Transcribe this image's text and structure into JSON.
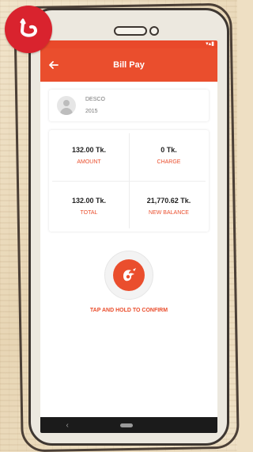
{
  "app": {
    "title": "Bill Pay"
  },
  "biller": {
    "name": "DESCO",
    "code": "2015"
  },
  "summary": [
    {
      "value": "132.00 Tk.",
      "label": "AMOUNT"
    },
    {
      "value": "0 Tk.",
      "label": "CHARGE"
    },
    {
      "value": "132.00 Tk.",
      "label": "TOTAL"
    },
    {
      "value": "21,770.62 Tk.",
      "label": "NEW BALANCE"
    }
  ],
  "confirm": {
    "text": "TAP AND HOLD TO CONFIRM"
  },
  "icons": {
    "back": "back-arrow-icon",
    "avatar": "user-avatar-icon",
    "confirm": "bkash-bird-icon",
    "logo": "brand-logo-icon"
  },
  "colors": {
    "accent": "#ea4e2d",
    "brand": "#d9232e",
    "navbar": "#1b1b1b"
  }
}
